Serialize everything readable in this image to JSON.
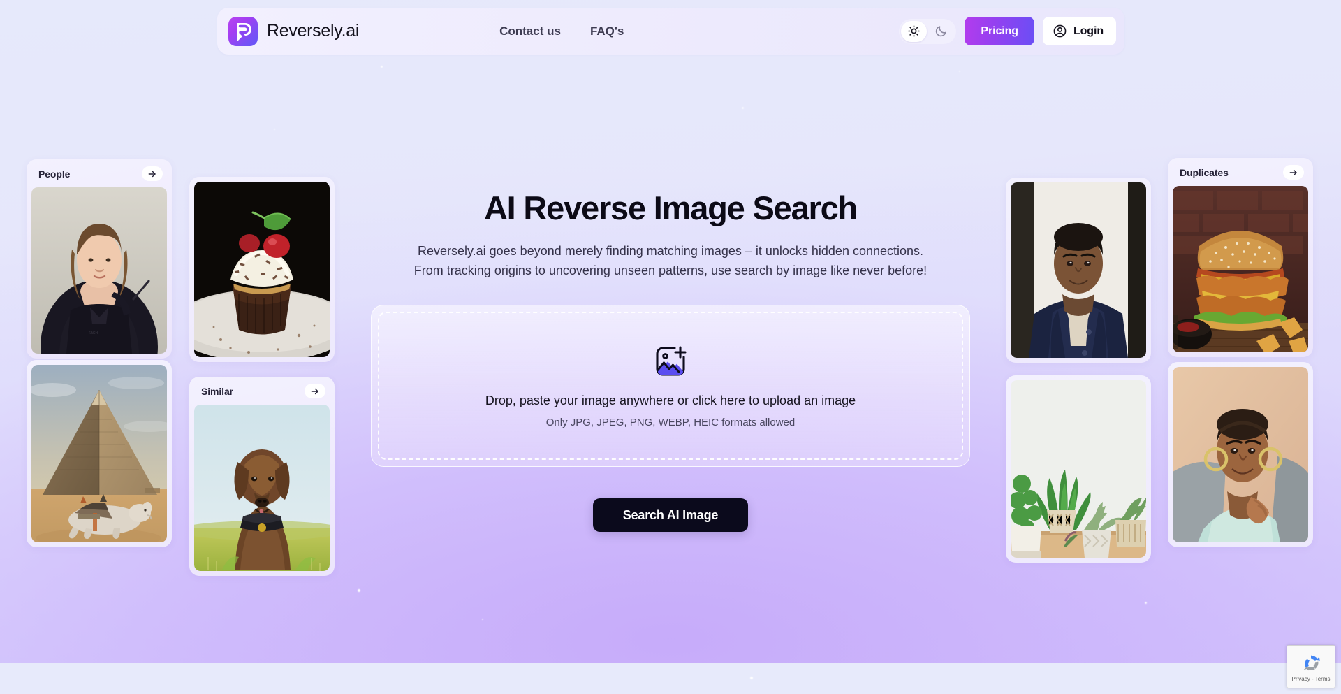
{
  "brand": {
    "name": "Reversely.ai",
    "logo_icon": "reversely-logo-icon",
    "accent_start": "#b845f0",
    "accent_end": "#6257f7"
  },
  "header": {
    "nav_links": [
      {
        "label": "Contact us",
        "name": "contact-us"
      },
      {
        "label": "FAQ's",
        "name": "faqs"
      }
    ],
    "theme_toggle": {
      "light_icon": "sun-icon",
      "dark_icon": "moon-icon",
      "active": "light"
    },
    "pricing_label": "Pricing",
    "login_label": "Login",
    "login_icon": "user-circle-icon"
  },
  "hero": {
    "title": "AI Reverse Image Search",
    "subtitle_line1": "Reversely.ai goes beyond merely finding matching images – it unlocks hidden connections.",
    "subtitle_line2": "From tracking origins to uncovering unseen patterns, use search by image like never before!"
  },
  "dropzone": {
    "icon": "image-add-icon",
    "main_text_before": "Drop, paste your image anywhere or click here to ",
    "upload_link": "upload an image",
    "formats_text": "Only JPG, JPEG, PNG, WEBP, HEIC formats allowed"
  },
  "actions": {
    "search_label": "Search AI Image"
  },
  "cards": {
    "people": {
      "label": "People",
      "arrow_icon": "arrow-right-icon",
      "photo": "woman-in-black-hoodie-portrait"
    },
    "similar": {
      "label": "Similar",
      "arrow_icon": "arrow-right-icon",
      "photo": "brown-labrador-dog-in-field"
    },
    "duplicates": {
      "label": "Duplicates",
      "arrow_icon": "arrow-right-icon",
      "photo": "fried-chicken-burger-with-cheese"
    }
  },
  "gallery": [
    {
      "name": "cupcake-photo",
      "photo": "chocolate-cupcake-with-cream-and-cherry"
    },
    {
      "name": "pyramid-photo",
      "photo": "giza-pyramid-with-resting-camel"
    },
    {
      "name": "man-portrait-photo",
      "photo": "smiling-man-in-navy-cardigan"
    },
    {
      "name": "plants-photo",
      "photo": "potted-green-houseplants-on-shelf"
    },
    {
      "name": "woman-portrait-photo",
      "photo": "smiling-woman-with-hoop-earrings"
    }
  ],
  "recaptcha": {
    "icon": "recaptcha-icon",
    "text": "Privacy - Terms"
  }
}
